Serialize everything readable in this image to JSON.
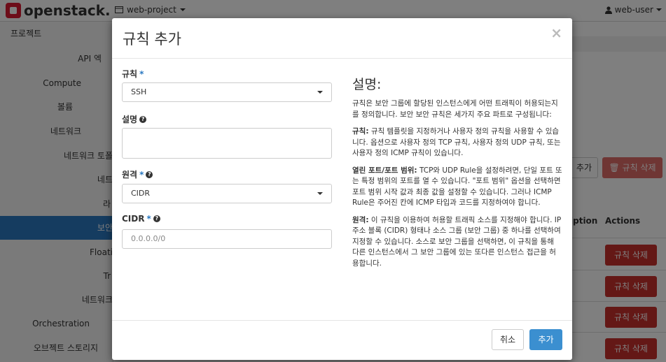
{
  "topbar": {
    "brand": "openstack.",
    "project": "web-project",
    "user": "web-user"
  },
  "sidebar": {
    "root": "프로젝트",
    "items": [
      {
        "label": "API 엑"
      },
      {
        "label": "Compute"
      },
      {
        "label": "볼륨"
      },
      {
        "label": "네트워크"
      },
      {
        "label": "네트워크 토폴"
      },
      {
        "label": "네트"
      },
      {
        "label": "라"
      },
      {
        "label": "보안"
      },
      {
        "label": "Floati"
      },
      {
        "label": "Tr"
      },
      {
        "label": "네트워크"
      },
      {
        "label": "Orchestration"
      },
      {
        "label": "오브젝트 스토리지"
      }
    ]
  },
  "background": {
    "add_button": "추가",
    "delete_button": "규칙 삭제",
    "col_description": "iption",
    "col_actions": "Actions",
    "row_delete": "규칙 삭제"
  },
  "modal": {
    "title": "규칙 추가",
    "close": "×",
    "fields": {
      "rule_label": "규칙",
      "rule_value": "SSH",
      "description_label": "설명",
      "remote_label": "원격",
      "remote_value": "CIDR",
      "cidr_label": "CIDR",
      "cidr_placeholder": "0.0.0.0/0"
    },
    "help": {
      "title": "설명:",
      "intro": "규칙은 보안 그룹에 할당된 인스턴스에게 어떤 트래픽이 허용되는지를 정의합니다. 보안 보안 규칙은 세가지 주요 파트로 구성됩니다:",
      "rule_head": "규칙:",
      "rule_text": " 규칙 템플릿을 지정하거나 사용자 정의 규칙을 사용할 수 있습니다. 옵션으로 사용자 정의 TCP 규칙, 사용자 정의 UDP 규칙, 또는 사용자 정의 ICMP 규칙이 있습니다.",
      "port_head": "열린 포트/포트 범위:",
      "port_text": " TCP와 UDP Rule을 설정하려면, 단일 포트 또는 특정 범위의 포트를 열 수 있습니다. \"포트 범위\" 옵션을 선택하면 포트 범위 시작 값과 최종 값을 설정할 수 있습니다. 그러나 ICMP Rule은 주어진 칸에 ICMP 타입과 코드를 지정하여야 합니다.",
      "remote_head": "원격:",
      "remote_text": " 이 규칙을 이용하여 허용할 트래픽 소스를 지정해야 합니다. IP 주소 블록 (CIDR) 형태나 소스 그룹 (보안 그룹) 중 하나를 선택하여 지정할 수 있습니다. 소스로 보안 그룹을 선택하면, 이 규칙을 통해 다른 인스턴스에서 그 보안 그룹에 있는 또다른 인스턴스 접근을 허용합니다."
    },
    "cancel": "취소",
    "submit": "추가"
  }
}
